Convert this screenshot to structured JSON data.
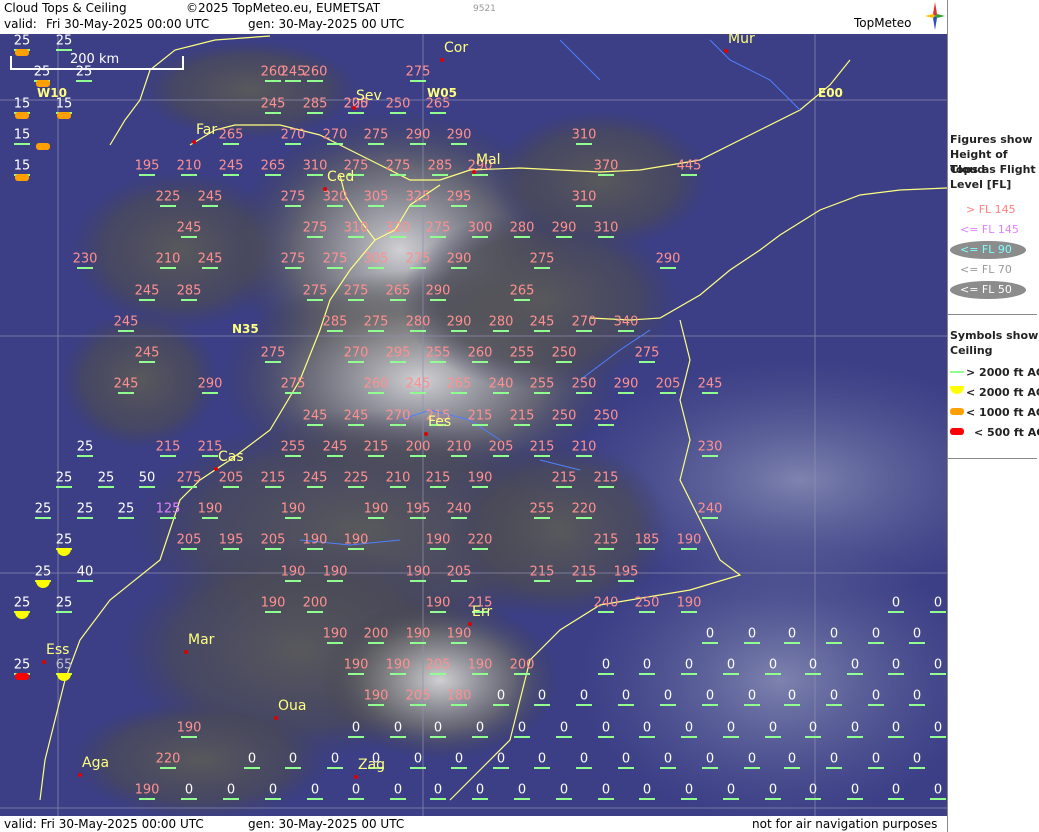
{
  "header": {
    "title": "Cloud Tops & Ceiling",
    "copyright": "©2025 TopMeteo.eu, EUMETSAT",
    "code": "9521",
    "valid_label": "valid:",
    "valid": "Fri  30-May-2025  00:00 UTC",
    "gen": "gen: 30-May-2025 00 UTC",
    "logo": "TopMeteo"
  },
  "footer": {
    "valid": "valid:  Fri  30-May-2025  00:00 UTC",
    "gen": "gen: 30-May-2025 00 UTC",
    "disclaimer": "not for air navigation purposes"
  },
  "scale": {
    "label": "200 km"
  },
  "grid_labels": [
    "W10",
    "W05",
    "E00",
    "N35"
  ],
  "cities": [
    "Cor",
    "Mur",
    "Sev",
    "Far",
    "Ced",
    "Mal",
    "Fes",
    "Cas",
    "Err",
    "Mar",
    "Ess",
    "Oua",
    "Aga",
    "Zag"
  ],
  "legend": {
    "tops_title": [
      "Figures show",
      "Height of Cloud",
      "Tops as Flight",
      "Level  [FL]"
    ],
    "tops_items": [
      {
        "label": "> FL 145",
        "color": "#ff8080"
      },
      {
        "label": "<= FL 145",
        "color": "#e080ff"
      },
      {
        "label": "<= FL 90",
        "color": "#80ffff"
      },
      {
        "label": "<= FL 70",
        "color": "#b0b0b0"
      },
      {
        "label": "<= FL 50",
        "color": "#ffffff"
      }
    ],
    "ceil_title": [
      "Symbols show",
      "Ceiling"
    ],
    "ceil_items": [
      {
        "label": "> 2000 ft AGL",
        "color": "#90ff90"
      },
      {
        "label": "< 2000 ft AGL",
        "color": "#ffff00"
      },
      {
        "label": "< 1000 ft AGL",
        "color": "#ffa000"
      },
      {
        "label": "< 500 ft AGL",
        "color": "#ff0000"
      }
    ]
  },
  "values": [
    [
      "25",
      "25",
      "",
      "",
      "",
      "",
      "",
      "",
      "",
      "",
      "",
      "",
      "",
      "",
      "",
      "",
      "",
      "",
      "",
      "",
      "",
      "",
      "",
      "",
      "",
      "",
      "",
      ""
    ],
    [
      "25",
      "25",
      "",
      "",
      "245",
      "260",
      "260",
      "",
      "",
      "",
      "275",
      "",
      "",
      "",
      "",
      "",
      "",
      "",
      "",
      "",
      "",
      "",
      "",
      "",
      "",
      "",
      "",
      ""
    ],
    [
      "15",
      "15",
      "",
      "",
      "245",
      "285",
      "225",
      "200",
      "250",
      "",
      "265",
      "",
      "",
      "",
      "",
      "",
      "",
      "",
      "",
      "",
      "",
      "",
      "",
      "",
      "",
      "",
      "",
      ""
    ],
    [
      "15",
      "",
      "",
      "",
      "265",
      "",
      "270",
      "270",
      "275",
      "290",
      "290",
      "",
      "",
      "",
      "310",
      "",
      "",
      "",
      "",
      "",
      "",
      "",
      "",
      "",
      "",
      "",
      "",
      ""
    ],
    [
      "15",
      "",
      "195",
      "210",
      "245",
      "265",
      "310",
      "275",
      "275",
      "285",
      "290",
      "",
      "",
      "",
      "",
      "370",
      "",
      "445",
      "",
      "",
      "",
      "",
      "",
      "",
      "",
      "",
      "",
      ""
    ],
    [
      "",
      "",
      "225",
      "245",
      "",
      "",
      "275",
      "320",
      "305",
      "325",
      "295",
      "",
      "",
      "",
      "310",
      "",
      "",
      "",
      "",
      "",
      "",
      "",
      "",
      "",
      "",
      "",
      "",
      ""
    ],
    [
      "",
      "",
      "",
      "245",
      "",
      "",
      "275",
      "310",
      "320",
      "275",
      "300",
      "280",
      "290",
      "310",
      "",
      "",
      "",
      "",
      "",
      "",
      "",
      "",
      "",
      "",
      "",
      "",
      "",
      ""
    ],
    [
      "",
      "230",
      "",
      "210",
      "245",
      "",
      "275",
      "275",
      "305",
      "275",
      "290",
      "",
      "275",
      "",
      "",
      "",
      "290",
      "",
      "",
      "",
      "",
      "",
      "",
      "",
      "",
      "",
      "",
      ""
    ]
  ]
}
